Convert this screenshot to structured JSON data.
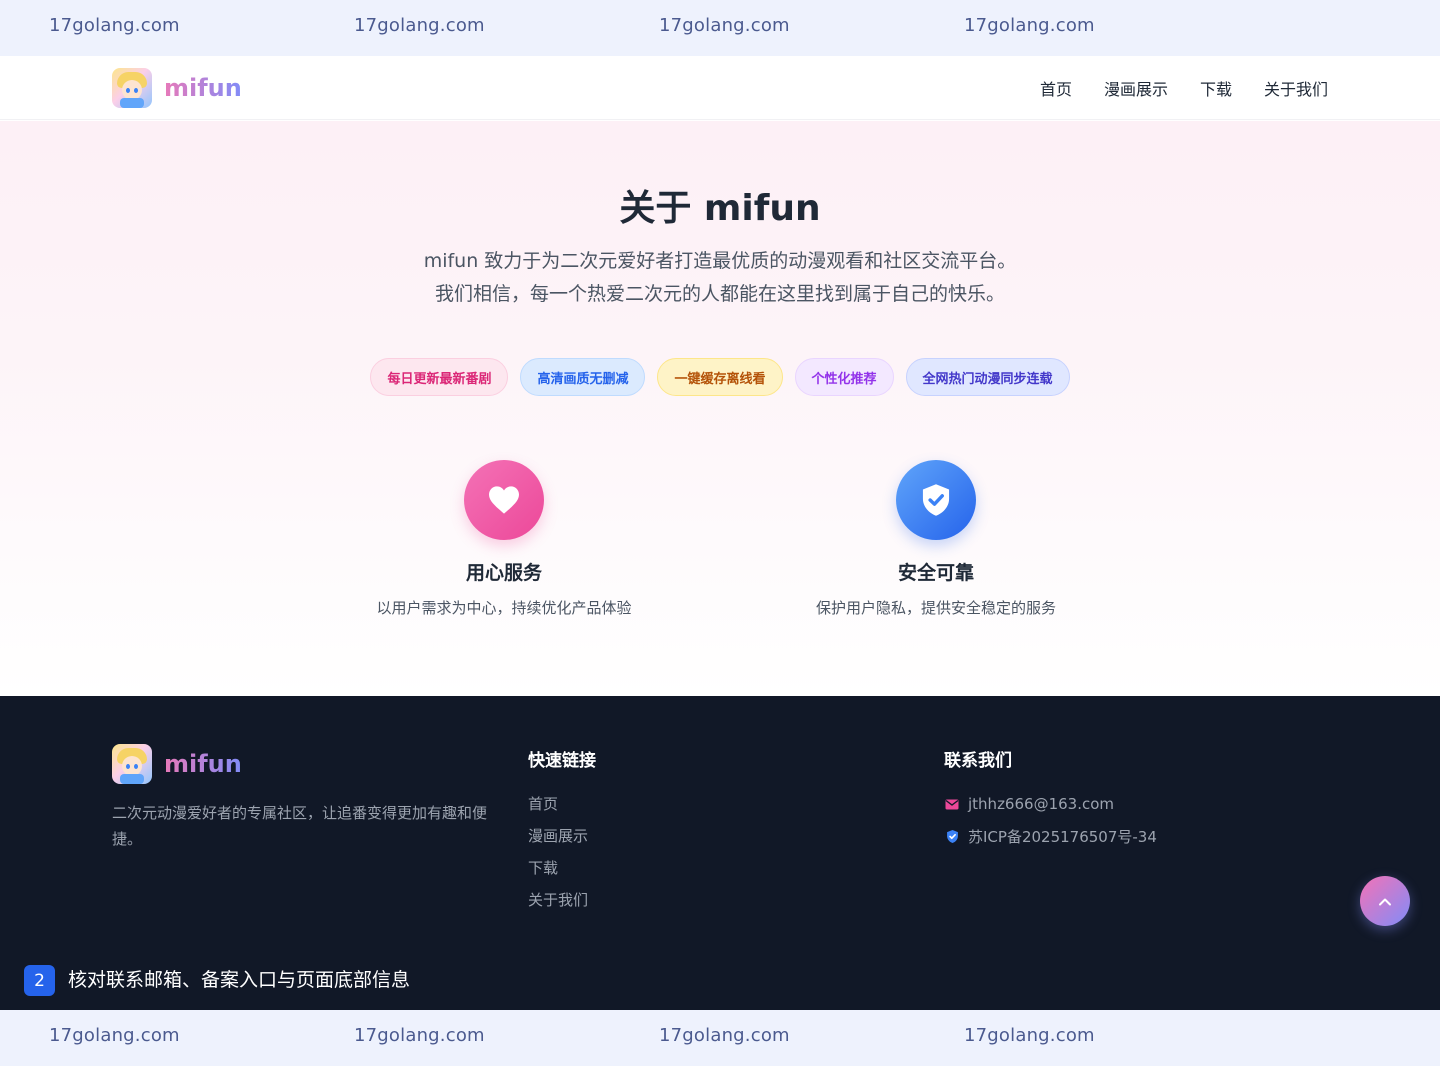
{
  "watermark": {
    "text": "17golang.com"
  },
  "navbar": {
    "brand": "mifun",
    "links": [
      "首页",
      "漫画展示",
      "下载",
      "关于我们"
    ]
  },
  "hero": {
    "title": "关于 mifun",
    "desc_line1": "mifun 致力于为二次元爱好者打造最优质的动漫观看和社区交流平台。",
    "desc_line2": "我们相信，每一个热爱二次元的人都能在这里找到属于自己的快乐。",
    "tags": [
      "每日更新最新番剧",
      "高清画质无删减",
      "一键缓存离线看",
      "个性化推荐",
      "全网热门动漫同步连载"
    ]
  },
  "features": [
    {
      "icon": "heart-icon",
      "title": "用心服务",
      "desc": "以用户需求为中心，持续优化产品体验"
    },
    {
      "icon": "shield-check-icon",
      "title": "安全可靠",
      "desc": "保护用户隐私，提供安全稳定的服务"
    }
  ],
  "footer": {
    "brand": "mifun",
    "desc": "二次元动漫爱好者的专属社区，让追番变得更加有趣和便捷。",
    "quick_links_title": "快速链接",
    "quick_links": [
      "首页",
      "漫画展示",
      "下载",
      "关于我们"
    ],
    "contact_title": "联系我们",
    "email": "jthhz666@163.com",
    "icp": "苏ICP备2025176507号-34"
  },
  "annotation": {
    "step": "2",
    "text": "核对联系邮箱、备案入口与页面底部信息"
  },
  "colors": {
    "accent_pink": "#ec4899",
    "accent_blue": "#2563eb",
    "footer_bg": "#111827"
  }
}
